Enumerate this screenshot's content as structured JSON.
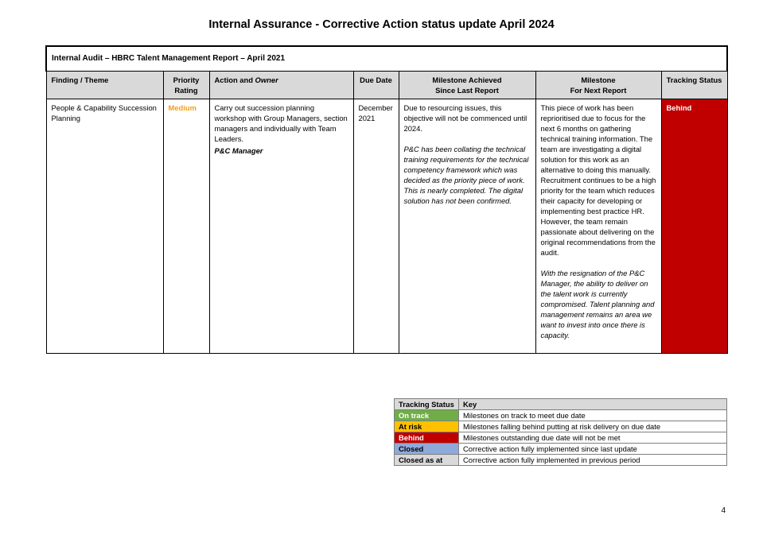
{
  "document": {
    "title": "Internal Assurance - Corrective Action status update April 2024",
    "page_number": "4"
  },
  "report": {
    "heading": "Internal Audit – HBRC Talent Management Report – April 2021",
    "columns": {
      "finding": "Finding / Theme",
      "priority_line1": "Priority",
      "priority_line2": "Rating",
      "action_prefix": "Action and ",
      "action_owner_word": "Owner",
      "due_date": "Due Date",
      "milestone_achieved_line1": "Milestone Achieved",
      "milestone_achieved_line2": "Since Last Report",
      "milestone_next_line1": "Milestone",
      "milestone_next_line2": "For Next Report",
      "tracking_status": "Tracking Status"
    },
    "row": {
      "finding": "People & Capability Succession Planning",
      "priority": "Medium",
      "action": "Carry out succession planning workshop with Group Managers, section managers and individually with Team Leaders.",
      "owner": "P&C Manager",
      "due_date": "December 2021",
      "milestone_achieved": "Due to resourcing issues, this objective will not be commenced until 2024.",
      "milestone_achieved_italic": "P&C has been collating the technical training requirements for the technical competency framework which was decided as the priority piece of work. This is nearly completed. The digital solution has not been confirmed.",
      "milestone_next": "This piece of work has been reprioritised due to focus for the next 6 months on gathering technical training information. The team are investigating a digital solution for this work as an alternative to doing this manually. Recruitment continues to be a high priority for the team which reduces their capacity for developing or implementing best practice HR. However, the team remain passionate about delivering on the original recommendations from the audit.",
      "milestone_next_italic": "With the resignation of the P&C Manager, the ability to deliver on the talent work is currently compromised. Talent planning and management remains an area we want to invest into once there is capacity.",
      "tracking_status": "Behind",
      "tracking_status_color": "#c00000"
    }
  },
  "key": {
    "headers": {
      "status": "Tracking Status",
      "key": "Key"
    },
    "items": [
      {
        "status": "On track",
        "description": "Milestones on track to meet due date",
        "bg": "#70ad47",
        "fg": "#ffffff"
      },
      {
        "status": "At risk",
        "description": "Milestones falling behind putting at risk delivery on due date",
        "bg": "#ffc000",
        "fg": "#000000"
      },
      {
        "status": "Behind",
        "description": "Milestones outstanding due date will not be met",
        "bg": "#c00000",
        "fg": "#ffffff"
      },
      {
        "status": "Closed",
        "description": "Corrective action fully implemented since last update",
        "bg": "#8eaadb",
        "fg": "#000000"
      },
      {
        "status": "Closed as at",
        "description": "Corrective action fully implemented in previous period",
        "bg": "#d9d9d9",
        "fg": "#000000"
      }
    ]
  }
}
